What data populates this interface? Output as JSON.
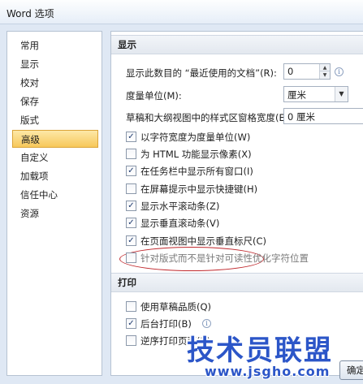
{
  "window": {
    "title": "Word 选项"
  },
  "sidebar": {
    "items": [
      {
        "label": "常用"
      },
      {
        "label": "显示"
      },
      {
        "label": "校对"
      },
      {
        "label": "保存"
      },
      {
        "label": "版式"
      },
      {
        "label": "高级",
        "selected": true
      },
      {
        "label": "自定义"
      },
      {
        "label": "加载项"
      },
      {
        "label": "信任中心"
      },
      {
        "label": "资源"
      }
    ]
  },
  "display_section": {
    "header": "显示",
    "recent_docs": {
      "label": "显示此数目的 “最近使用的文档”(R):",
      "value": "0"
    },
    "units": {
      "label": "度量单位(M):",
      "value": "厘米"
    },
    "style_width": {
      "label": "草稿和大纲视图中的样式区窗格宽度(E):",
      "value": "0 厘米"
    },
    "options": [
      {
        "label": "以字符宽度为度量单位(W)",
        "checked": true
      },
      {
        "label": "为 HTML 功能显示像素(X)",
        "checked": false
      },
      {
        "label": "在任务栏中显示所有窗口(I)",
        "checked": true
      },
      {
        "label": "在屏幕提示中显示快捷键(H)",
        "checked": false
      },
      {
        "label": "显示水平滚动条(Z)",
        "checked": true
      },
      {
        "label": "显示垂直滚动条(V)",
        "checked": true
      },
      {
        "label": "在页面视图中显示垂直标尺(C)",
        "checked": true
      },
      {
        "label": "针对版式而不是针对可读性优化字符位置",
        "checked": false,
        "disabled": true
      }
    ]
  },
  "print_section": {
    "header": "打印",
    "options": [
      {
        "label": "使用草稿品质(Q)",
        "checked": false
      },
      {
        "label": "后台打印(B)",
        "checked": true
      },
      {
        "label": "逆序打印页面(R)",
        "checked": false
      }
    ]
  },
  "footer": {
    "ok_label": "确定"
  },
  "watermark": {
    "brand": "技术员联盟",
    "url": "www.jsgho.com"
  },
  "icons": {
    "check": "✓",
    "info": "i",
    "up": "▲",
    "down": "▼",
    "dropdown": "▼"
  },
  "colors": {
    "accent": "#f7c85a",
    "highlight_ring": "#c0282d",
    "watermark": "#2c56c8"
  }
}
